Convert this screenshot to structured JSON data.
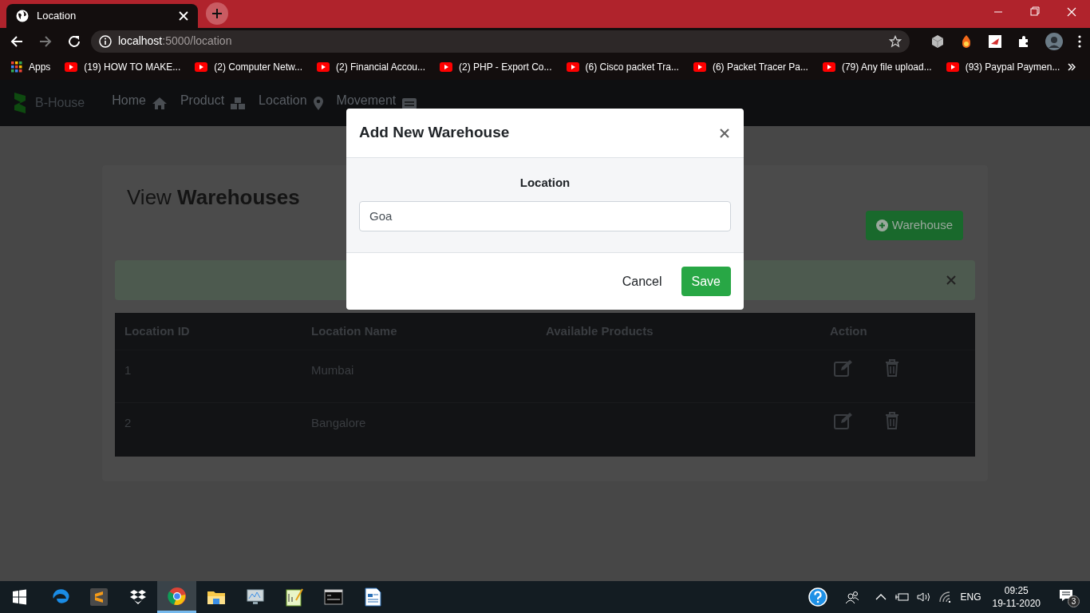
{
  "browser": {
    "tab": {
      "title": "Location"
    },
    "address": {
      "host": "localhost",
      "path": ":5000/location"
    },
    "bookmarks": [
      {
        "kind": "apps",
        "label": "Apps"
      },
      {
        "kind": "video",
        "label": "(19) HOW TO MAKE..."
      },
      {
        "kind": "video",
        "label": "(2) Computer Netw..."
      },
      {
        "kind": "video",
        "label": "(2) Financial Accou..."
      },
      {
        "kind": "video",
        "label": "(2) PHP - Export Co..."
      },
      {
        "kind": "video",
        "label": "(6) Cisco packet Tra..."
      },
      {
        "kind": "video",
        "label": "(6) Packet Tracer Pa..."
      },
      {
        "kind": "video",
        "label": "(79) Any file upload..."
      },
      {
        "kind": "video",
        "label": "(93) Paypal Paymen..."
      }
    ]
  },
  "navbar": {
    "brand": "B-House",
    "items": [
      {
        "label": "Home",
        "kind": "home"
      },
      {
        "label": "Product",
        "kind": "boxes"
      },
      {
        "label": "Location",
        "kind": "pin"
      },
      {
        "label": "Movement",
        "kind": "card"
      }
    ]
  },
  "page": {
    "title_light": "View",
    "title_bold": "Warehouses",
    "add_button": "Warehouse",
    "table": {
      "columns": [
        "Location ID",
        "Location Name",
        "Available Products",
        "Action"
      ],
      "rows": [
        {
          "id": "1",
          "name": "Mumbai"
        },
        {
          "id": "2",
          "name": "Bangalore"
        }
      ]
    }
  },
  "modal": {
    "title": "Add New Warehouse",
    "field_label": "Location",
    "field_value": "Goa",
    "buttons": [
      {
        "kind": "cancel",
        "label": "Cancel"
      },
      {
        "kind": "save",
        "label": "Save"
      }
    ]
  },
  "taskbar": {
    "apps": [
      {
        "kind": "edge",
        "selected": false
      },
      {
        "kind": "sublime",
        "selected": false
      },
      {
        "kind": "dropbox",
        "selected": false
      },
      {
        "kind": "chrome",
        "selected": true
      },
      {
        "kind": "folder",
        "selected": false
      },
      {
        "kind": "monitor",
        "selected": false
      },
      {
        "kind": "notepad",
        "selected": false
      },
      {
        "kind": "terminal",
        "selected": false
      },
      {
        "kind": "document",
        "selected": false
      }
    ],
    "language": "ENG",
    "time": "09:25",
    "date": "19-11-2020",
    "notifications": "3"
  }
}
